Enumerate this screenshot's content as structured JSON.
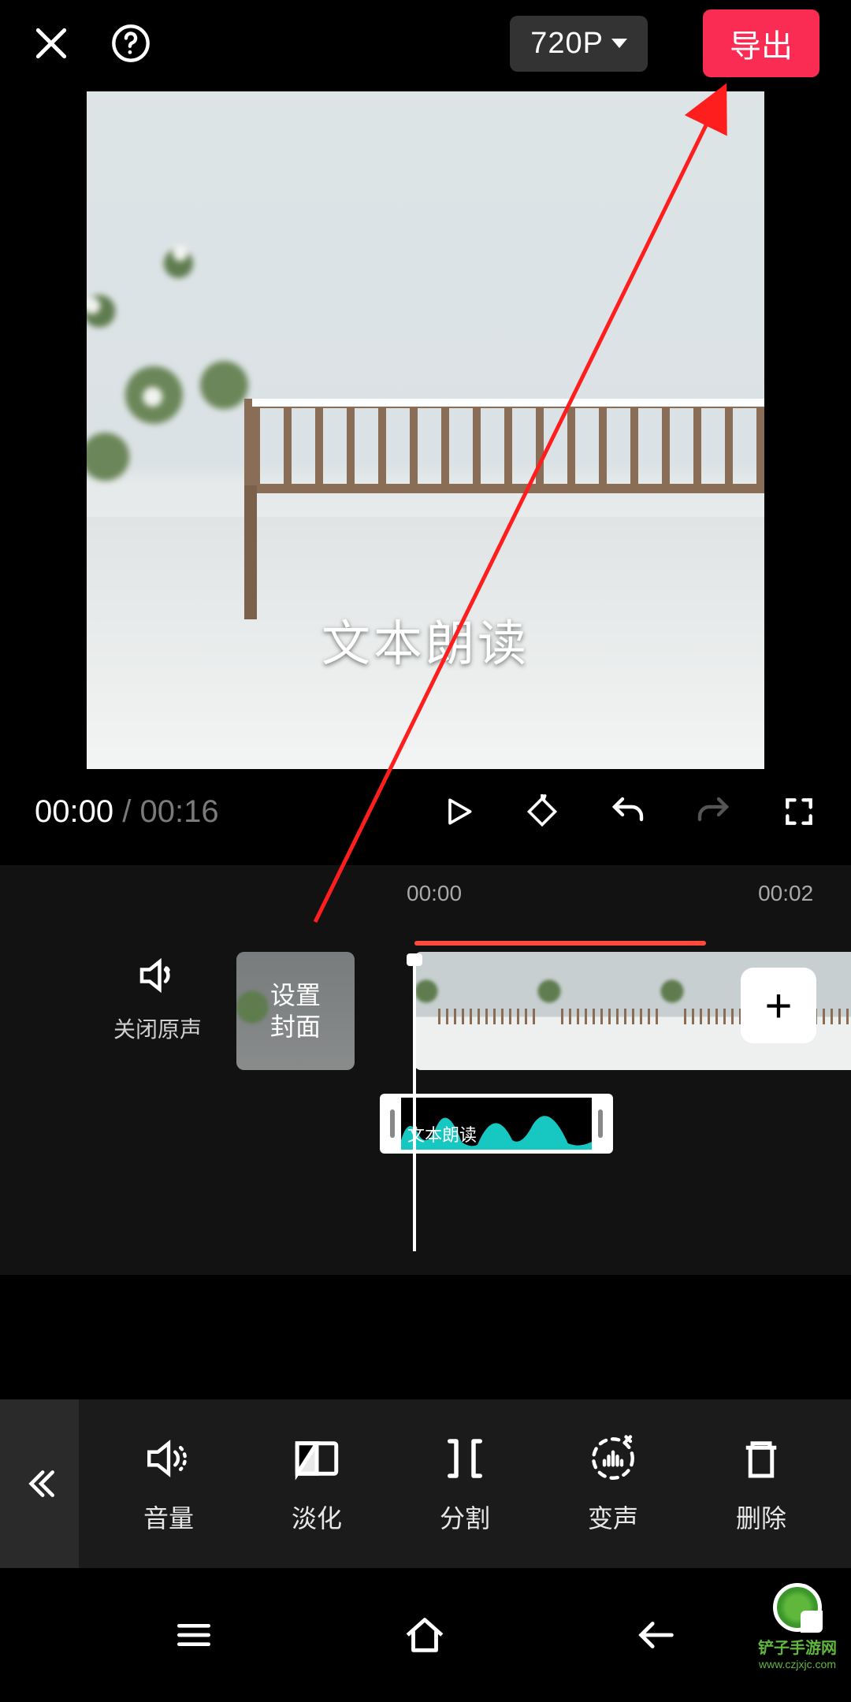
{
  "header": {
    "resolution_label": "720P",
    "export_label": "导出"
  },
  "preview": {
    "caption": "文本朗读"
  },
  "playback": {
    "current_time": "00:00",
    "duration": "00:16"
  },
  "ruler": {
    "marks": [
      "00:00",
      "00:02"
    ]
  },
  "timeline": {
    "mute_label": "关闭原声",
    "cover_label": "设置\n封面",
    "audio_clip_label": "文本朗读"
  },
  "toolbar": {
    "items": [
      {
        "id": "volume",
        "label": "音量"
      },
      {
        "id": "fade",
        "label": "淡化"
      },
      {
        "id": "split",
        "label": "分割"
      },
      {
        "id": "voicechange",
        "label": "变声"
      },
      {
        "id": "delete",
        "label": "删除"
      }
    ]
  },
  "watermark": {
    "name": "铲子手游网",
    "url": "www.czjxjc.com"
  }
}
